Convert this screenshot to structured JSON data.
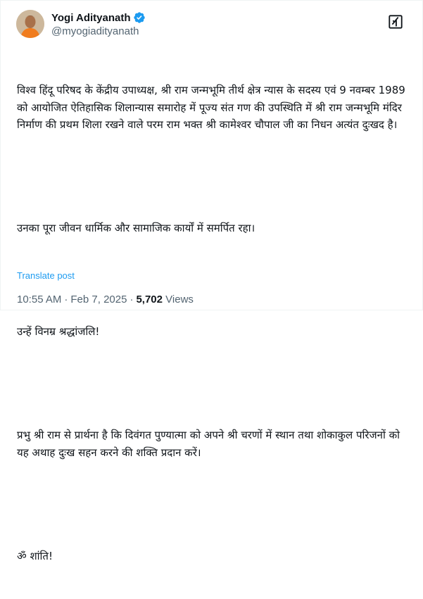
{
  "author": {
    "display_name": "Yogi Adityanath",
    "handle": "@myogiadityanath"
  },
  "colors": {
    "link": "#1d9bf0",
    "verified": "#1d9bf0",
    "secondary_text": "#536471",
    "primary_text": "#0f1419"
  },
  "icons": {
    "verified": "verified-badge-icon",
    "grok": "grok-icon"
  },
  "post": {
    "paragraphs": [
      "विश्व हिंदू परिषद के केंद्रीय उपाध्यक्ष, श्री राम जन्मभूमि तीर्थ क्षेत्र न्यास के सदस्य एवं 9 नवम्बर 1989 को आयोजित ऐतिहासिक शिलान्यास समारोह में पूज्य संत गण की उपस्थिति में श्री राम जन्मभूमि मंदिर निर्माण की प्रथम शिला रखने वाले परम राम भक्त श्री कामेश्वर चौपाल जी का निधन अत्यंत दुःखद है।",
      "उनका पूरा जीवन धार्मिक और सामाजिक कार्यों में समर्पित रहा।",
      "उन्हें विनम्र श्रद्धांजलि!",
      "प्रभु श्री राम से प्रार्थना है कि दिवंगत पुण्यात्मा को अपने श्री चरणों में स्थान तथा शोकाकुल परिजनों को यह अथाह दुःख सहन करने की शक्ति प्रदान करें।",
      "ॐ शांति!"
    ],
    "translate_label": "Translate post"
  },
  "meta": {
    "time": "10:55 AM",
    "separator": "·",
    "date": "Feb 7, 2025",
    "views_count": "5,702",
    "views_label": "Views"
  }
}
